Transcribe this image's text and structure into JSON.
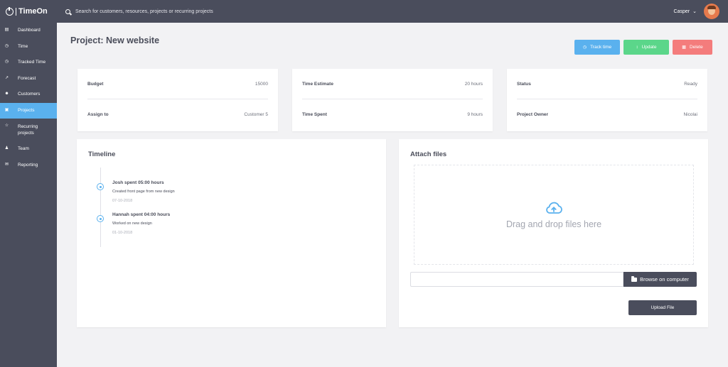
{
  "app": {
    "name": "TimeOn"
  },
  "search": {
    "placeholder": "Search for customers, resources, projects or recurring projects"
  },
  "user": {
    "name": "Casper"
  },
  "sidebar": {
    "items": [
      {
        "label": "Dashboard",
        "icon": "dashboard-icon"
      },
      {
        "label": "Time",
        "icon": "time-icon"
      },
      {
        "label": "Tracked Time",
        "icon": "clock-icon"
      },
      {
        "label": "Forecast",
        "icon": "trend-icon"
      },
      {
        "label": "Customers",
        "icon": "user-icon"
      },
      {
        "label": "Projects",
        "icon": "folder-icon",
        "active": true
      },
      {
        "label": "Recurring projects",
        "icon": "star-icon"
      },
      {
        "label": "Team",
        "icon": "team-icon"
      },
      {
        "label": "Reporting",
        "icon": "envelope-icon"
      }
    ]
  },
  "page": {
    "title": "Project: New website"
  },
  "actions": {
    "track_time": "Track time",
    "update": "Update",
    "delete": "Delete"
  },
  "info_cards": [
    {
      "rows": [
        {
          "label": "Budget",
          "value": "15000"
        },
        {
          "label": "Assign to",
          "value": "Customer 5"
        }
      ]
    },
    {
      "rows": [
        {
          "label": "Time Estimate",
          "value": "20 hours"
        },
        {
          "label": "Time Spent",
          "value": "9 hours"
        }
      ]
    },
    {
      "rows": [
        {
          "label": "Status",
          "value": "Ready"
        },
        {
          "label": "Project Owner",
          "value": "Nicolai"
        }
      ]
    }
  ],
  "timeline": {
    "title": "Timeline",
    "entries": [
      {
        "heading": "Josh spent 05:00 hours",
        "description": "Created front page from new design",
        "date": "07-10-2018"
      },
      {
        "heading": "Hannah spent 04:00 hours",
        "description": "Worked on new design",
        "date": "01-10-2018"
      }
    ]
  },
  "attach": {
    "title": "Attach files",
    "drop_text": "Drag and drop files here",
    "browse_label": "Browse on computer",
    "upload_label": "Upload File"
  },
  "colors": {
    "sidebar_bg": "#4a4d5c",
    "accent_blue": "#5ab1ee",
    "update_green": "#5bd68a",
    "delete_red": "#f47c7c"
  }
}
